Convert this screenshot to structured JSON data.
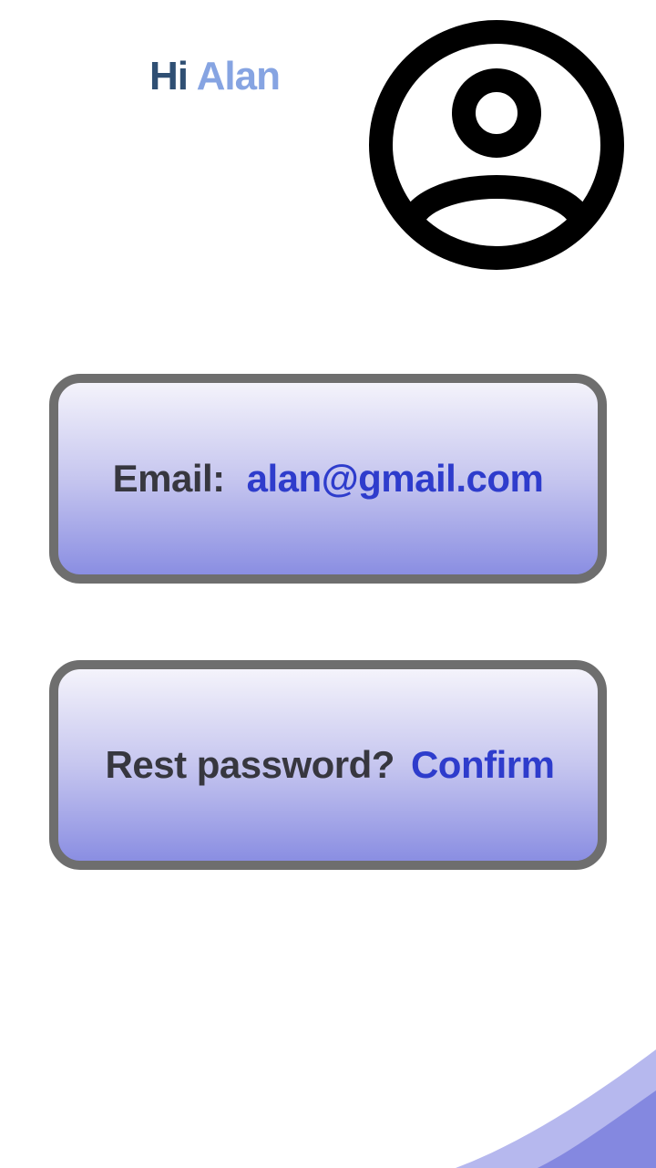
{
  "greeting": {
    "hi": "Hi",
    "name": "Alan"
  },
  "email_card": {
    "label": "Email:",
    "value": "alan@gmail.com"
  },
  "reset_card": {
    "label": "Rest password?",
    "action": "Confirm"
  },
  "icons": {
    "avatar": "user-circle-icon"
  },
  "colors": {
    "greeting_hi": "#2f4f73",
    "greeting_name": "#86a4e2",
    "label_text": "#37373f",
    "value_text": "#2e3ccc",
    "card_border": "#6e6e6e",
    "card_gradient_top": "#f4f3fb",
    "card_gradient_bottom": "#8a8ee2",
    "wave_light": "#b6b8ee",
    "wave_dark": "#8488e0"
  }
}
